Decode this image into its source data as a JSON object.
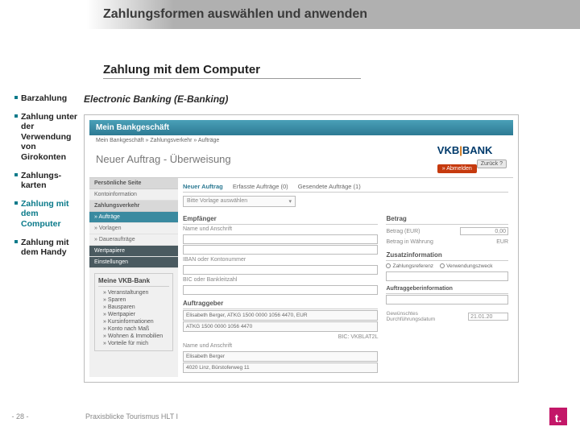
{
  "header": {
    "title": "Zahlungsformen auswählen und anwenden"
  },
  "subheader": "Zahlung mit dem Computer",
  "sidebar": {
    "items": [
      {
        "label": "Barzahlung",
        "active": false
      },
      {
        "label": "Zahlung unter der Verwendung von Girokonten",
        "active": false
      },
      {
        "label": "Zahlungs-\nkarten",
        "active": false
      },
      {
        "label": "Zahlung mit dem Computer",
        "active": true
      },
      {
        "label": "Zahlung mit dem Handy",
        "active": false
      }
    ]
  },
  "content": {
    "title": "Electronic Banking (E-Banking)"
  },
  "ebanking": {
    "window_title": "Mein Bankgeschäft",
    "breadcrumb": "Mein Bankgeschäft » Zahlungsverkehr » Aufträge",
    "page_title": "Neuer Auftrag - Überweisung",
    "bank_name": {
      "pre": "VKB",
      "bar": "|",
      "post": "BANK"
    },
    "logout": "» Abmelden",
    "back": "Zurück  ?",
    "nav": {
      "sec1": "Persönliche Seite",
      "item_konto": "Kontoinformation",
      "sec2": "Zahlungsverkehr",
      "item_auftraege": "» Aufträge",
      "item_vorlagen": "» Vorlagen",
      "item_dauer": "» Daueraufträge",
      "sec_wert": "Wertpapiere",
      "sec_einst": "Einstellungen",
      "box_title": "Meine VKB-Bank",
      "box_items": [
        "» Veranstaltungen",
        "» Sparen",
        "» Bausparen",
        "» Wertpapier",
        "» Kursinformationen",
        "» Konto nach Maß",
        "» Wohnen & Immobilien",
        "» Vorteile für mich"
      ]
    },
    "tabs": [
      "Neuer Auftrag",
      "Erfasste Aufträge (0)",
      "Gesendete Aufträge (1)"
    ],
    "vorlage_placeholder": "Bitte Vorlage auswählen",
    "labels": {
      "empfaenger": "Empfänger",
      "name_anschrift": "Name und Anschrift",
      "iban": "IBAN oder Kontonummer",
      "bic": "BIC oder Bankleitzahl",
      "auftraggeber": "Auftraggeber",
      "betrag": "Betrag",
      "betrag_eur": "Betrag (EUR)",
      "betrag_val": "0,00",
      "betrag_wahr": "Betrag in Währung",
      "eur": "EUR",
      "zusatz": "Zusatzinformation",
      "rad1": "Zahlungsreferenz",
      "rad2": "Verwendungszweck",
      "auftraggeberinfo": "Auftraggeberinformation",
      "datum_lbl": "Gewünschtes Durchführungsdatum",
      "datum_val": "21.01.20"
    },
    "prefill": {
      "line1": "Elisabeth Berger, ATKG 1500 0000 1056 4470, EUR",
      "line2": "ATKG 1500 0000 1056 4470",
      "line3": "BIC: VKBLAT2L",
      "line4": "Name und Anschrift",
      "line5": "Elisabeth Berger",
      "line6": "4020 Linz, Bürstoferweg 11"
    }
  },
  "footer": {
    "page": "- 28 -",
    "text": "Praxisblicke Tourismus HLT I",
    "logo": "t."
  }
}
